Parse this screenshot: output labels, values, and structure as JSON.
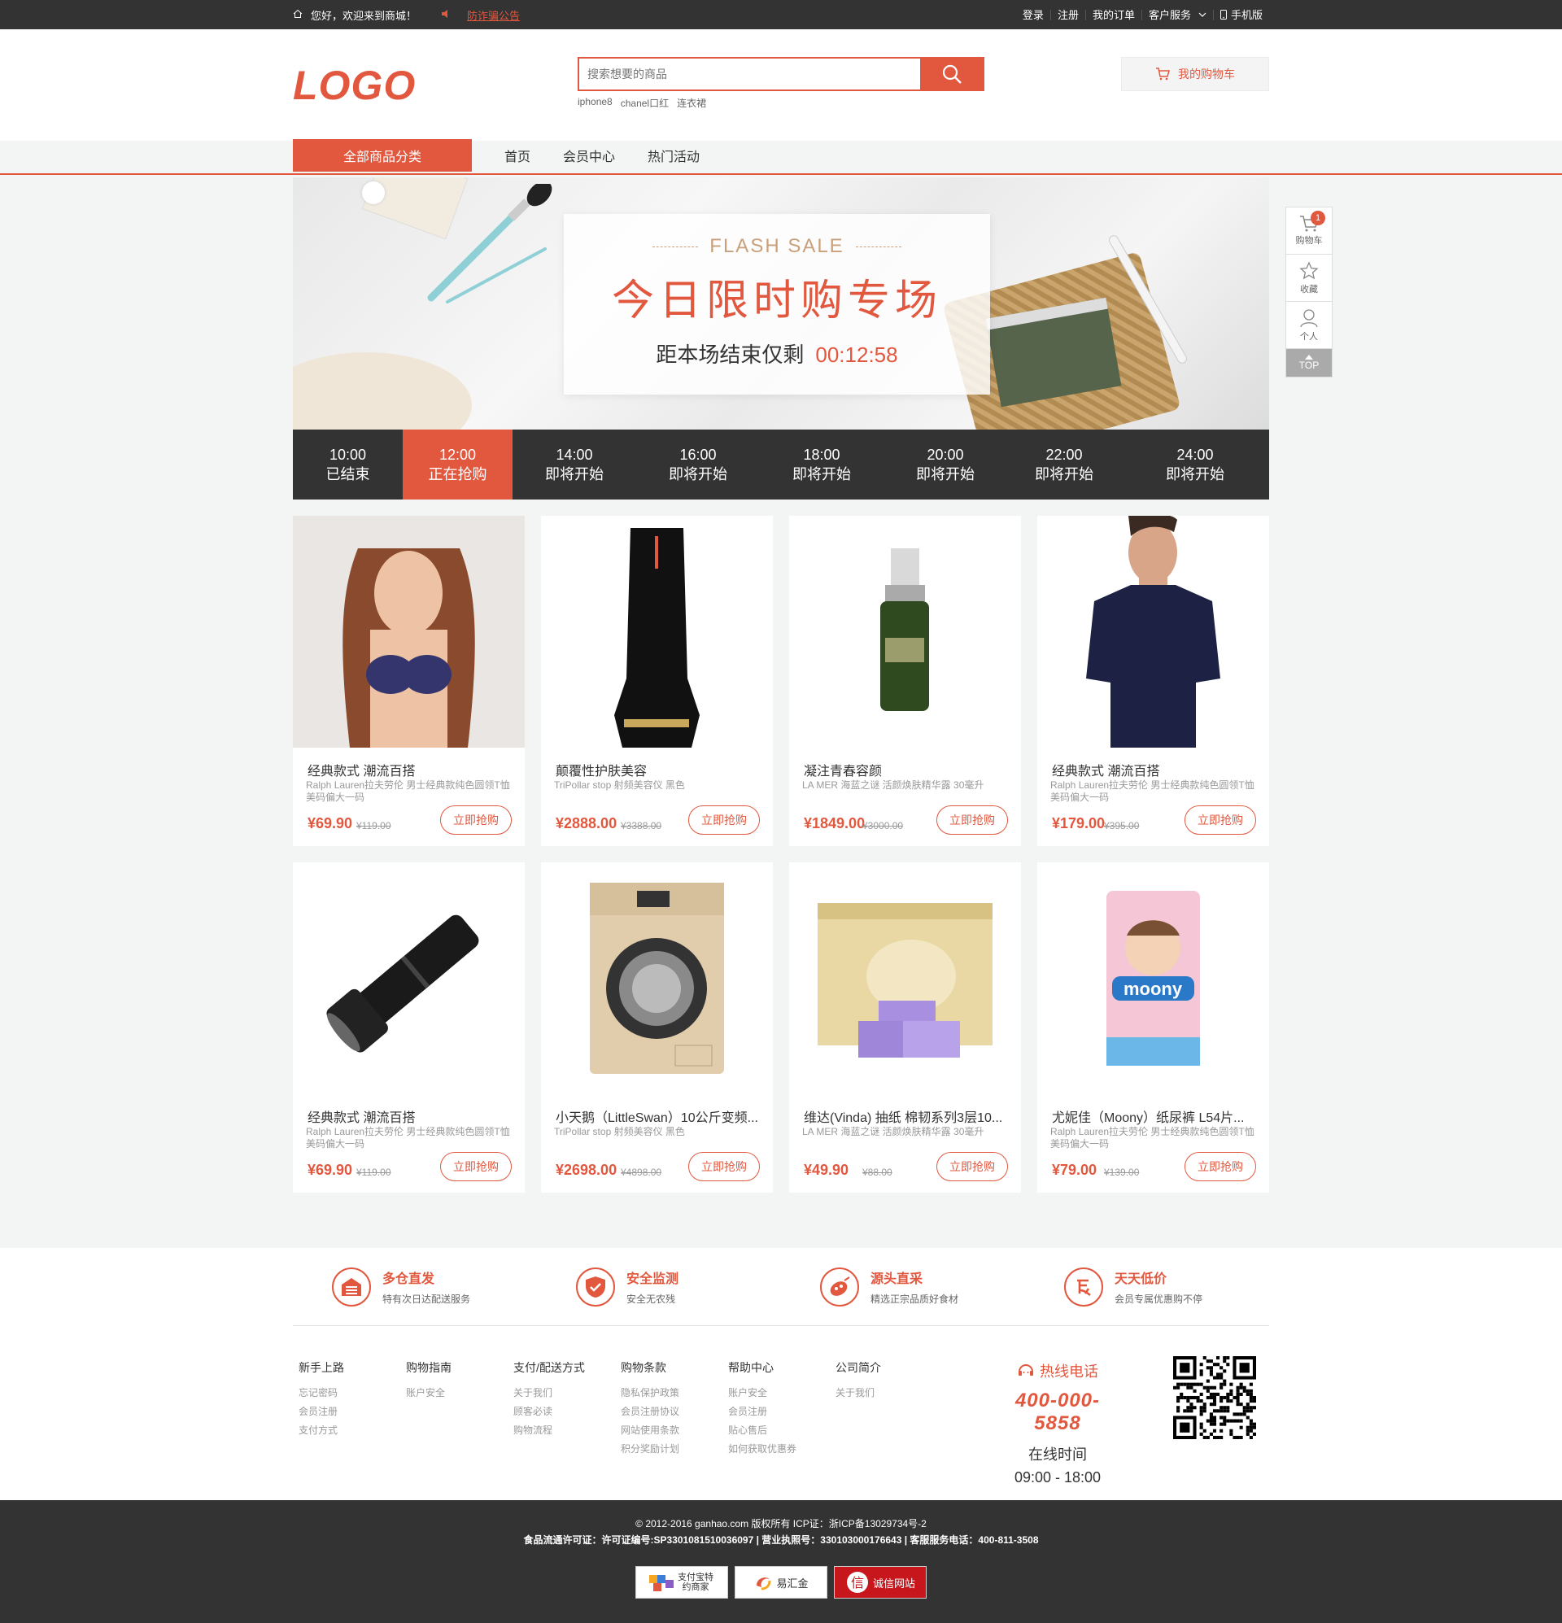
{
  "topbar": {
    "welcome": "您好，欢迎来到商城！",
    "notice": "防诈骗公告",
    "login": "登录",
    "register": "注册",
    "orders": "我的订单",
    "service": "客户服务",
    "mobile": "手机版"
  },
  "header": {
    "logo_text": "LOGO",
    "search_placeholder": "搜索想要的商品",
    "hotwords": [
      "iphone8",
      "chanel口红",
      "连衣裙"
    ],
    "cart_label": "我的购物车"
  },
  "nav": {
    "all_categories": "全部商品分类",
    "links": [
      "首页",
      "会员中心",
      "热门活动"
    ]
  },
  "banner": {
    "flash": "FLASH SALE",
    "title": "今日限时购专场",
    "countdown_label": "距本场结束仅剩",
    "countdown": "00:12:58"
  },
  "timeline": [
    {
      "time": "10:00",
      "status": "已结束"
    },
    {
      "time": "12:00",
      "status": "正在抢购"
    },
    {
      "time": "14:00",
      "status": "即将开始"
    },
    {
      "time": "16:00",
      "status": "即将开始"
    },
    {
      "time": "18:00",
      "status": "即将开始"
    },
    {
      "time": "20:00",
      "status": "即将开始"
    },
    {
      "time": "22:00",
      "status": "即将开始"
    },
    {
      "time": "24:00",
      "status": "即将开始"
    }
  ],
  "timeline_active": 1,
  "products": [
    {
      "title": "经典款式 潮流百搭",
      "desc": "Ralph Lauren拉夫劳伦 男士经典款纯色圆领T恤 美码偏大一码",
      "price": "¥69.90",
      "old": "¥119.00",
      "buy": "立即抢购",
      "icon": "bra-image"
    },
    {
      "title": "颠覆性护肤美容",
      "desc": "TriPollar stop 射频美容仪 黑色",
      "price": "¥2888.00",
      "old": "¥3388.00",
      "buy": "立即抢购",
      "icon": "beauty-device-image"
    },
    {
      "title": "凝注青春容颜",
      "desc": "LA MER 海蓝之谜 活颜焕肤精华露 30毫升",
      "price": "¥1849.00",
      "old": "¥3000.00",
      "buy": "立即抢购",
      "icon": "serum-bottle-image"
    },
    {
      "title": "经典款式 潮流百搭",
      "desc": "Ralph Lauren拉夫劳伦 男士经典款纯色圆领T恤 美码偏大一码",
      "price": "¥179.00",
      "old": "¥395.00",
      "buy": "立即抢购",
      "icon": "tshirt-image"
    },
    {
      "title": "经典款式 潮流百搭",
      "desc": "Ralph Lauren拉夫劳伦 男士经典款纯色圆领T恤 美码偏大一码",
      "price": "¥69.90",
      "old": "¥119.00",
      "buy": "立即抢购",
      "icon": "flashlight-image"
    },
    {
      "title": "小天鹅（LittleSwan）10公斤变频...",
      "desc": "TriPollar stop 射频美容仪 黑色",
      "price": "¥2698.00",
      "old": "¥4898.00",
      "buy": "立即抢购",
      "icon": "washing-machine-image"
    },
    {
      "title": "维达(Vinda) 抽纸 棉韧系列3层10...",
      "desc": "LA MER 海蓝之谜 活颜焕肤精华露 30毫升",
      "price": "¥49.90",
      "old": "¥88.00",
      "buy": "立即抢购",
      "icon": "tissue-box-image"
    },
    {
      "title": "尤妮佳（Moony）纸尿裤 L54片...",
      "desc": "Ralph Lauren拉夫劳伦 男士经典款纯色圆领T恤 美码偏大一码",
      "price": "¥79.00",
      "old": "¥139.00",
      "buy": "立即抢购",
      "icon": "diaper-pack-image"
    }
  ],
  "sidebar": {
    "cart": "购物车",
    "cart_count": "1",
    "fav": "收藏",
    "me": "个人",
    "top": "TOP"
  },
  "promises": [
    {
      "title": "多仓直发",
      "sub": "特有次日达配送服务",
      "icon": "warehouse-icon"
    },
    {
      "title": "安全监测",
      "sub": "安全无农残",
      "icon": "shield-check-icon"
    },
    {
      "title": "源头直采",
      "sub": "精选正宗品质好食材",
      "icon": "fresh-food-icon"
    },
    {
      "title": "天天低价",
      "sub": "会员专属优惠购不停",
      "icon": "low-price-icon"
    }
  ],
  "link_columns": [
    {
      "title": "新手上路",
      "items": [
        "忘记密码",
        "会员注册",
        "支付方式"
      ]
    },
    {
      "title": "购物指南",
      "items": [
        "账户安全"
      ]
    },
    {
      "title": "支付/配送方式",
      "items": [
        "关于我们",
        "顾客必读",
        "购物流程"
      ]
    },
    {
      "title": "购物条款",
      "items": [
        "隐私保护政策",
        "会员注册协议",
        "网站使用条款",
        "积分奖励计划"
      ]
    },
    {
      "title": "帮助中心",
      "items": [
        "账户安全",
        "会员注册",
        "贴心售后",
        "如何获取优惠券"
      ]
    },
    {
      "title": "公司简介",
      "items": [
        "关于我们"
      ]
    }
  ],
  "hotline": {
    "label": "热线电话",
    "phone": "400-000-5858",
    "online": "在线时间",
    "hours": "09:00 - 18:00"
  },
  "copyright": {
    "line1": "© 2012-2016 ganhao.com 版权所有 ICP证：浙ICP备13029734号-2",
    "line2": "食品流通许可证：许可证编号:SP3301081510036097 | 营业执照号：330103000176643 | 客服服务电话：400-811-3508",
    "badges": [
      "支付宝特约商家",
      "易汇金",
      "诚信网站"
    ]
  },
  "colors": {
    "accent": "#e2583f",
    "dark": "#333333"
  }
}
